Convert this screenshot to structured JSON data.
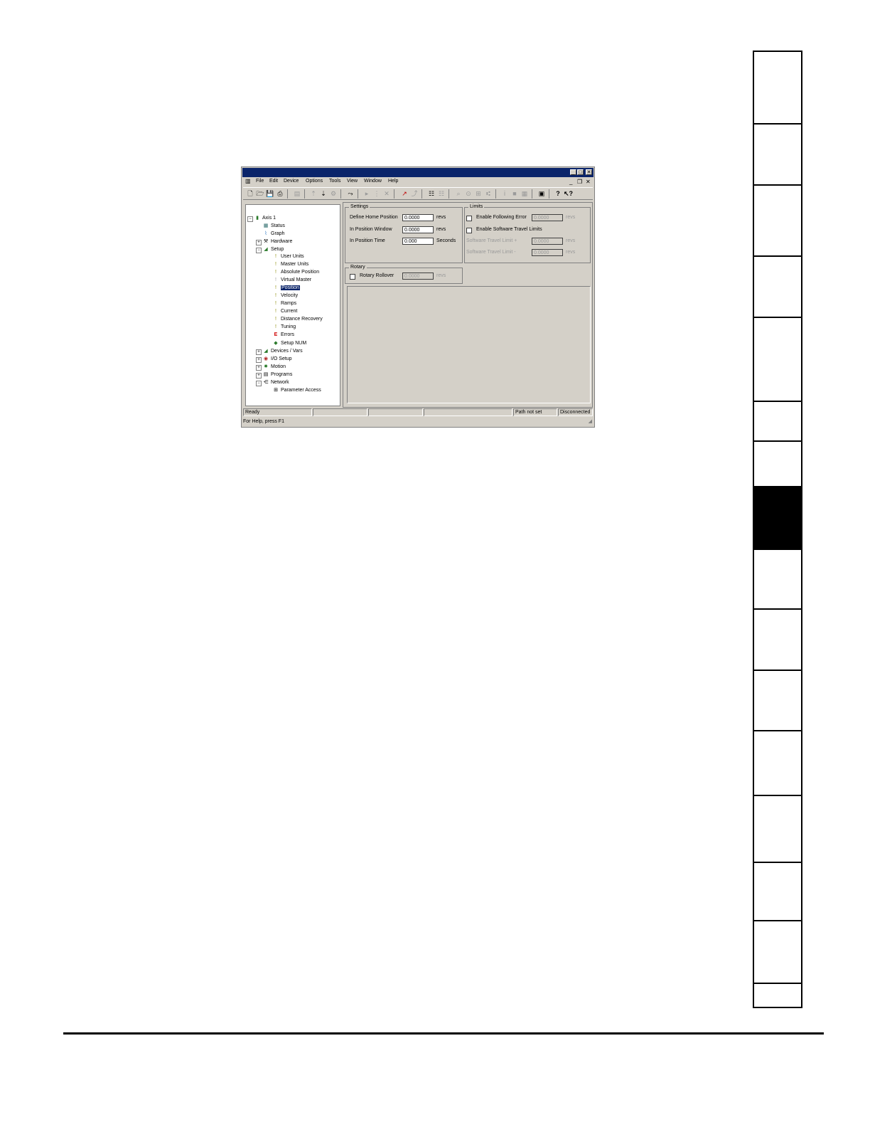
{
  "window": {
    "menu": [
      "File",
      "Edit",
      "Device",
      "Options",
      "Tools",
      "View",
      "Window",
      "Help"
    ],
    "caption_buttons": [
      "_",
      "□",
      "✕"
    ],
    "mdi_buttons": [
      "_",
      "❐",
      "✕"
    ]
  },
  "tree": {
    "root": "Axis 1",
    "status": "Status",
    "graph": "Graph",
    "hardware": "Hardware",
    "setup": "Setup",
    "user_units": "User Units",
    "master_units": "Master Units",
    "absolute_position": "Absolute Position",
    "virtual_master": "Virtual Master",
    "position": "Position",
    "velocity": "Velocity",
    "ramps": "Ramps",
    "current": "Current",
    "distance_recovery": "Distance Recovery",
    "tuning": "Tuning",
    "errors": "Errors",
    "setup_num": "Setup NUM",
    "devices_vars": "Devices / Vars",
    "io_setup": "I/O Setup",
    "motion": "Motion",
    "programs": "Programs",
    "network": "Network",
    "parameter_access": "Parameter Access"
  },
  "settings": {
    "title": "Settings",
    "define_home_label": "Define Home Position",
    "define_home_value": "0.0000",
    "define_home_unit": "revs",
    "window_label": "In Position Window",
    "window_value": "0.0000",
    "window_unit": "revs",
    "time_label": "In Position Time",
    "time_value": "0.000",
    "time_unit": "Seconds"
  },
  "limits": {
    "title": "Limits",
    "following_label": "Enable Following Error",
    "following_value": "0.0000",
    "following_unit": "revs",
    "travel_label": "Enable Software Travel Limits",
    "plus_label": "Software Travel Limit +",
    "plus_value": "0.0000",
    "plus_unit": "revs",
    "minus_label": "Software Travel Limit -",
    "minus_value": "0.0000",
    "minus_unit": "revs"
  },
  "rotary": {
    "title": "Rotary",
    "label": "Rotary Rollover",
    "value": "0.0000",
    "unit": "revs"
  },
  "statusbar": {
    "ready": "Ready",
    "path": "Path not set",
    "connection": "Disconnected"
  },
  "helpbar": "For Help, press F1"
}
